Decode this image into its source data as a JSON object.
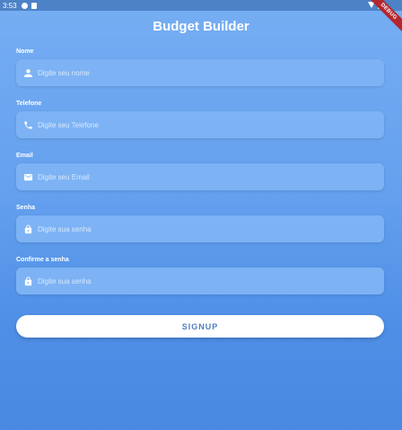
{
  "status_bar": {
    "time": "3:53"
  },
  "debug_banner": "DEBUG",
  "header": {
    "title": "Budget Builder"
  },
  "form": {
    "name": {
      "label": "Nome",
      "placeholder": "Digite seu nome",
      "icon": "person-icon"
    },
    "phone": {
      "label": "Telefone",
      "placeholder": "Digite seu Telefone",
      "icon": "phone-icon"
    },
    "email": {
      "label": "Email",
      "placeholder": "Digite seu Email",
      "icon": "email-icon"
    },
    "password": {
      "label": "Senha",
      "placeholder": "Digite sua senha",
      "icon": "lock-icon"
    },
    "confirm_password": {
      "label": "Confirme a senha",
      "placeholder": "Digite sua senha",
      "icon": "lock-icon"
    }
  },
  "signup_label": "SIGNUP",
  "colors": {
    "background_top": "#76aef3",
    "background_bottom": "#4a89e2",
    "field_fill": "#7db3f4",
    "button_text": "#4e7fc0"
  }
}
